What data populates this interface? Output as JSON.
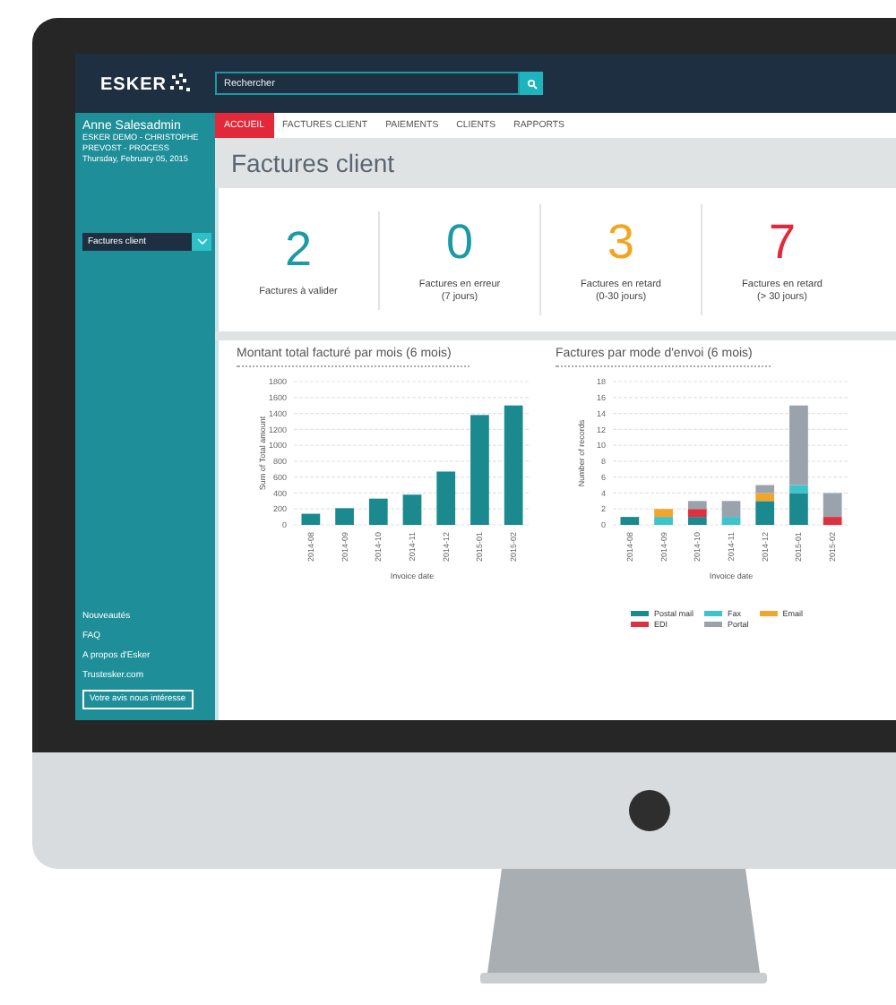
{
  "topbar": {
    "logo": "ESKER",
    "search": {
      "placeholder": "Rechercher"
    }
  },
  "sidebar": {
    "user": "Anne Salesadmin",
    "company": "ESKER DEMO - CHRISTOPHE PREVOST - PROCESS",
    "date": "Thursday, February 05, 2015",
    "dropdown": {
      "value": "Factures client"
    },
    "links": [
      "Nouveautés",
      "FAQ",
      "A propos d'Esker",
      "Trustesker.com"
    ],
    "feedback_button": "Votre avis nous intéresse"
  },
  "tabs": [
    {
      "label": "ACCUEIL",
      "selected": true
    },
    {
      "label": "FACTURES CLIENT",
      "selected": false
    },
    {
      "label": "PAIEMENTS",
      "selected": false
    },
    {
      "label": "CLIENTS",
      "selected": false
    },
    {
      "label": "RAPPORTS",
      "selected": false
    }
  ],
  "page_title": "Factures client",
  "kpis": [
    {
      "value": "2",
      "lines": [
        "Factures à valider"
      ],
      "color": "#1a9aa6"
    },
    {
      "value": "0",
      "lines": [
        "Factures en erreur",
        "(7 jours)"
      ],
      "color": "#1a9aa6"
    },
    {
      "value": "3",
      "lines": [
        "Factures en retard",
        "(0-30 jours)"
      ],
      "color": "#f2a51f"
    },
    {
      "value": "7",
      "lines": [
        "Factures en retard",
        "(> 30 jours)"
      ],
      "color": "#e3283a"
    }
  ],
  "charts": [
    {
      "title": "Montant total facturé par mois (6 mois)",
      "chart_data": {
        "type": "bar",
        "xlabel": "Invoice date",
        "ylabel": "Sum of Total amount",
        "categories": [
          "2014-08",
          "2014-09",
          "2014-10",
          "2014-11",
          "2014-12",
          "2015-01",
          "2015-02"
        ],
        "values": [
          140,
          210,
          330,
          380,
          670,
          1380,
          1500
        ],
        "grid": true,
        "ylim": [
          0,
          1800
        ],
        "yticks": [
          0,
          200,
          400,
          600,
          800,
          1000,
          1200,
          1400,
          1600,
          1800
        ]
      }
    },
    {
      "title": "Factures par mode d'envoi (6 mois)",
      "chart_data": {
        "type": "bar",
        "stacked": true,
        "xlabel": "Invoice date",
        "ylabel": "Number of records",
        "categories": [
          "2014-08",
          "2014-09",
          "2014-10",
          "2014-11",
          "2014-12",
          "2015-01",
          "2015-02"
        ],
        "series": [
          {
            "name": "Postal mail",
            "color": "#1b8a8f",
            "values": [
              1,
              0,
              1,
              0,
              3,
              4,
              0
            ]
          },
          {
            "name": "Fax",
            "color": "#3cc4cc",
            "values": [
              0,
              1,
              0,
              1,
              0,
              1,
              0
            ]
          },
          {
            "name": "Email",
            "color": "#f2a52a",
            "values": [
              0,
              1,
              0,
              0,
              1,
              0,
              0
            ]
          },
          {
            "name": "EDI",
            "color": "#e0303f",
            "values": [
              0,
              0,
              1,
              0,
              0,
              0,
              1
            ]
          },
          {
            "name": "Portal",
            "color": "#9aa3ab",
            "values": [
              0,
              0,
              1,
              2,
              1,
              10,
              3
            ]
          }
        ],
        "grid": true,
        "ylim": [
          0,
          18
        ],
        "yticks": [
          0,
          2,
          4,
          6,
          8,
          10,
          12,
          14,
          16,
          18
        ]
      }
    }
  ]
}
